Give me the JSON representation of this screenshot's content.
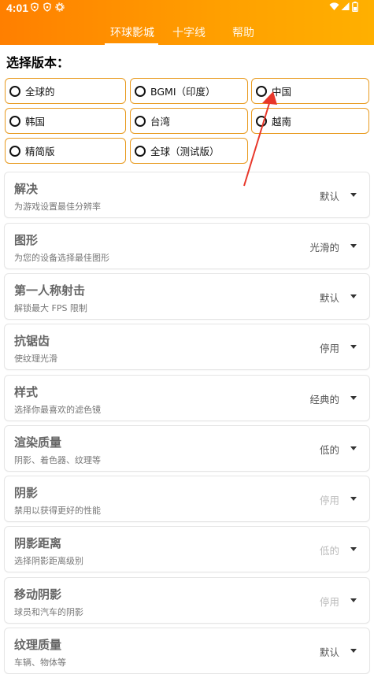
{
  "status_bar": {
    "time": "4:01",
    "left_icons": [
      "shield-icon",
      "shield-icon",
      "gear-icon"
    ],
    "right_icons": [
      "wifi-icon",
      "signal-icon",
      "battery-icon"
    ]
  },
  "tabs": [
    {
      "label": "环球影城",
      "active": true
    },
    {
      "label": "十字线",
      "active": false
    },
    {
      "label": "帮助",
      "active": false
    }
  ],
  "version_section": {
    "title": "选择版本：",
    "options": [
      {
        "label": "全球的"
      },
      {
        "label": "BGMI（印度）"
      },
      {
        "label": "中国"
      },
      {
        "label": "韩国"
      },
      {
        "label": "台湾"
      },
      {
        "label": "越南"
      },
      {
        "label": "精简版"
      },
      {
        "label": "全球（测试版）"
      }
    ]
  },
  "settings": [
    {
      "title": "解决",
      "subtitle": "为游戏设置最佳分辨率",
      "value": "默认",
      "enabled": true
    },
    {
      "title": "图形",
      "subtitle": "为您的设备选择最佳图形",
      "value": "光滑的",
      "enabled": true
    },
    {
      "title": "第一人称射击",
      "subtitle": "解锁最大 FPS 限制",
      "value": "默认",
      "enabled": true
    },
    {
      "title": "抗锯齿",
      "subtitle": "使纹理光滑",
      "value": "停用",
      "enabled": true
    },
    {
      "title": "样式",
      "subtitle": "选择你最喜欢的滤色镜",
      "value": "经典的",
      "enabled": true
    },
    {
      "title": "渲染质量",
      "subtitle": "阴影、着色器、纹理等",
      "value": "低的",
      "enabled": true
    },
    {
      "title": "阴影",
      "subtitle": "禁用以获得更好的性能",
      "value": "停用",
      "enabled": false
    },
    {
      "title": "阴影距离",
      "subtitle": "选择阴影距离级别",
      "value": "低的",
      "enabled": false
    },
    {
      "title": "移动阴影",
      "subtitle": "球员和汽车的阴影",
      "value": "停用",
      "enabled": false
    },
    {
      "title": "纹理质量",
      "subtitle": "车辆、物体等",
      "value": "默认",
      "enabled": true
    }
  ],
  "colors": {
    "header_start": "#ff7f00",
    "header_end": "#ffb000",
    "option_border": "#e89a1e",
    "annotation_arrow": "#e8372a"
  }
}
